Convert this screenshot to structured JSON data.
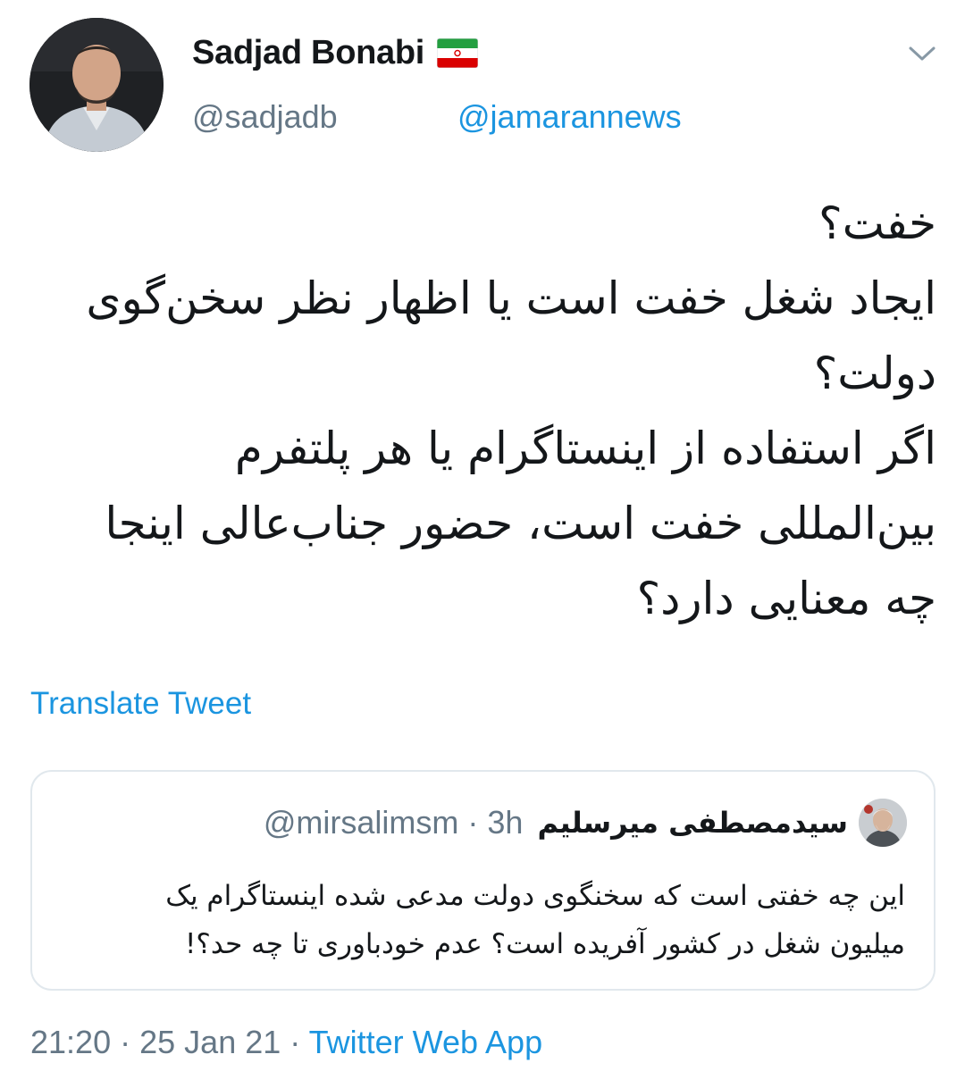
{
  "author": {
    "display_name": "Sadjad Bonabi",
    "handle": "@sadjadb",
    "flag_icon": "iran-flag-icon",
    "avatar_icon": "profile-photo-avatar"
  },
  "reply_to": "@jamarannews",
  "menu_icon": "chevron-down-icon",
  "tweet": {
    "lines": [
      "خفت؟",
      "ایجاد شغل خفت است یا اظهار نظر سخن‌گوی",
      "دولت؟",
      "اگر استفاده از اینستاگرام یا هر پلتفرم",
      "بین‌المللی خفت است، حضور جناب‌عالی اینجا",
      "چه معنایی دارد؟"
    ]
  },
  "translate_label": "Translate Tweet",
  "quoted_tweet": {
    "display_name": "سیدمصطفی میرسلیم",
    "handle": "@mirsalimsm",
    "time": "3h",
    "lines": [
      "این چه خفتی است که سخنگوی دولت مدعی شده اینستاگرام یک",
      "میلیون شغل در کشور آفریده است؟ عدم خودباوری تا چه حد؟!"
    ]
  },
  "footer": {
    "time": "21:20",
    "date": "25 Jan 21",
    "source": "Twitter Web App",
    "separator": "·"
  },
  "colors": {
    "link": "#1b95e0",
    "secondary_text": "#657786",
    "border": "#e1e8ed",
    "primary_text": "#14171a"
  }
}
